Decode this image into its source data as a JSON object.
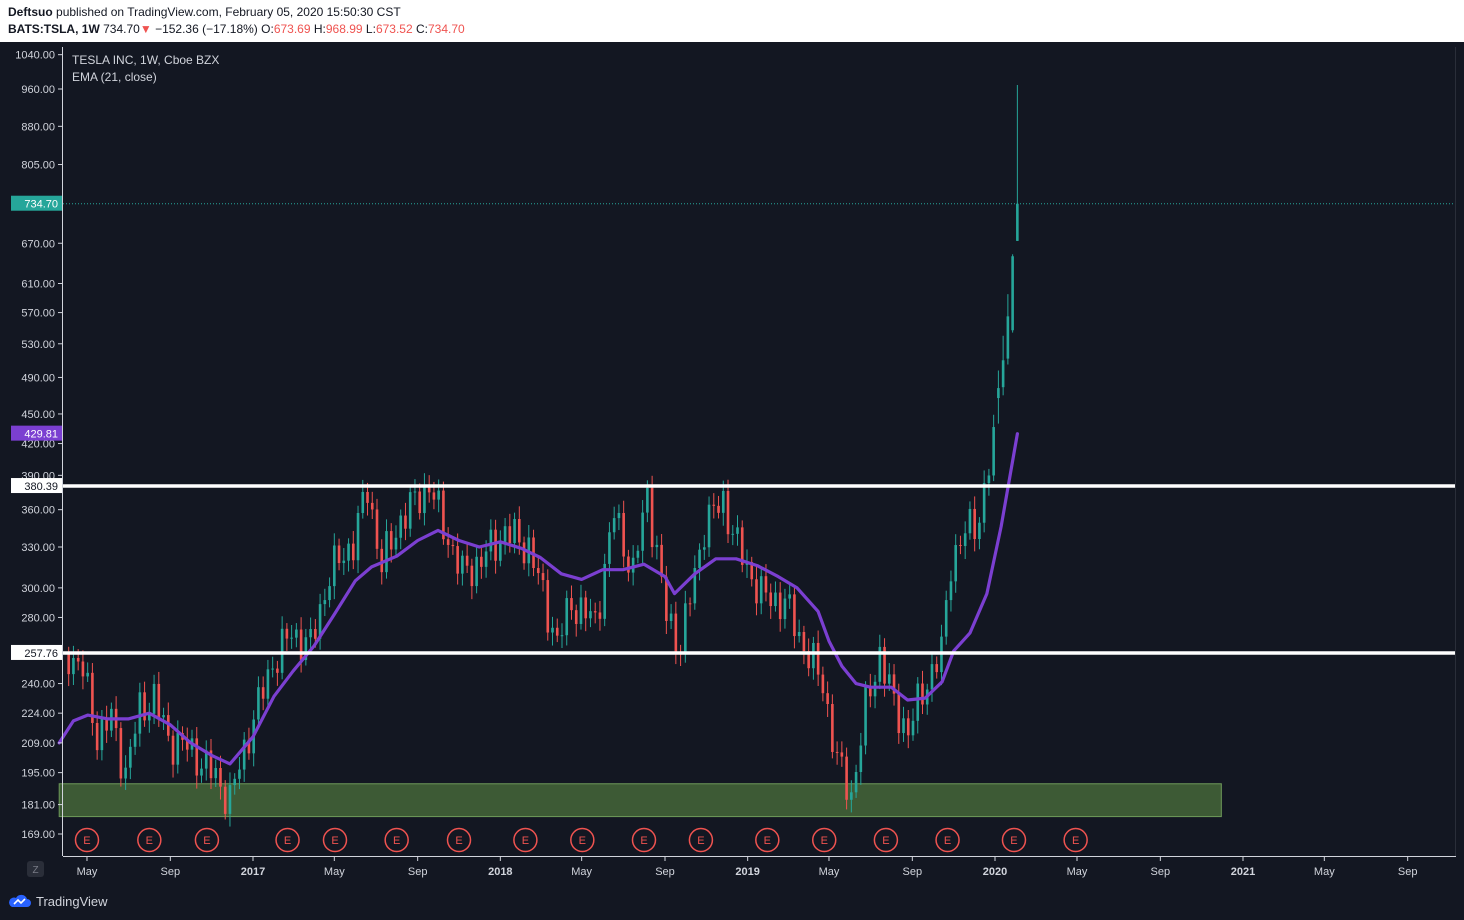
{
  "header": {
    "author": "Deftsuo",
    "published_text": "published on TradingView.com, February 05, 2020 15:50:30 CST",
    "symbol": "BATS:TSLA, 1W",
    "last": "734.70",
    "change_arrow": "▼",
    "change": "−152.36 (−17.18%)",
    "open_label": "O:",
    "open": "673.69",
    "high_label": "H:",
    "high": "968.99",
    "low_label": "L:",
    "low": "673.52",
    "close_label": "C:",
    "close": "734.70"
  },
  "legend": {
    "title": "TESLA INC, 1W, Cboe BZX",
    "indicator": "EMA (21, close)"
  },
  "footer": {
    "brand": "TradingView",
    "corner_label": "Z"
  },
  "colors": {
    "background": "#131722",
    "up": "#26a69a",
    "down": "#ef5350",
    "ema": "#7b3fd1",
    "support_zone": "#3d5a35",
    "levels": "#ffffff",
    "earnings": "#ef5350"
  },
  "chart_data": {
    "type": "candlestick",
    "title": "TESLA INC, 1W, Cboe BZX",
    "interval": "1W",
    "y_scale": "log",
    "y_ticks": [
      1040,
      960,
      880,
      805,
      670,
      610,
      570,
      530,
      490,
      450,
      420,
      390,
      360,
      330,
      300,
      280,
      240,
      224,
      209,
      195,
      181,
      169
    ],
    "y_tick_labels": [
      "1040.00",
      "960.00",
      "880.00",
      "805.00",
      "670.00",
      "610.00",
      "570.00",
      "530.00",
      "490.00",
      "450.00",
      "420.00",
      "390.00",
      "360.00",
      "330.00",
      "300.00",
      "280.00",
      "240.00",
      "224.00",
      "209.00",
      "195.00",
      "181.00",
      "169.00"
    ],
    "x_ticks": [
      {
        "label": "May",
        "date": "2016-05-01",
        "bold": false
      },
      {
        "label": "Sep",
        "date": "2016-09-01",
        "bold": false
      },
      {
        "label": "2017",
        "date": "2017-01-01",
        "bold": true
      },
      {
        "label": "May",
        "date": "2017-05-01",
        "bold": false
      },
      {
        "label": "Sep",
        "date": "2017-09-01",
        "bold": false
      },
      {
        "label": "2018",
        "date": "2018-01-01",
        "bold": true
      },
      {
        "label": "May",
        "date": "2018-05-01",
        "bold": false
      },
      {
        "label": "Sep",
        "date": "2018-09-01",
        "bold": false
      },
      {
        "label": "2019",
        "date": "2019-01-01",
        "bold": true
      },
      {
        "label": "May",
        "date": "2019-05-01",
        "bold": false
      },
      {
        "label": "Sep",
        "date": "2019-09-01",
        "bold": false
      },
      {
        "label": "2020",
        "date": "2020-01-01",
        "bold": true
      },
      {
        "label": "May",
        "date": "2020-05-01",
        "bold": false
      },
      {
        "label": "Sep",
        "date": "2020-09-01",
        "bold": false
      },
      {
        "label": "2021",
        "date": "2021-01-01",
        "bold": true
      },
      {
        "label": "May",
        "date": "2021-05-01",
        "bold": false
      },
      {
        "label": "Sep",
        "date": "2021-09-01",
        "bold": false
      }
    ],
    "price_labels": [
      {
        "text": "734.70",
        "value": 734.7,
        "bg": "#26a69a",
        "fg": "#ffffff"
      },
      {
        "text": "429.81",
        "value": 429.81,
        "bg": "#7b3fd1",
        "fg": "#ffffff"
      },
      {
        "text": "380.39",
        "value": 380.39,
        "bg": "#ffffff",
        "fg": "#131722"
      },
      {
        "text": "257.76",
        "value": 257.76,
        "bg": "#ffffff",
        "fg": "#131722"
      }
    ],
    "horizontal_levels": [
      380.39,
      257.76
    ],
    "last_price": 734.7,
    "support_zone": {
      "from": "2016-03-21",
      "to": "2020-11-30",
      "top": 190,
      "bottom": 176
    },
    "earnings_label": "E",
    "earnings_dates": [
      "2016-05-01",
      "2016-08-01",
      "2016-10-25",
      "2017-02-21",
      "2017-05-02",
      "2017-08-01",
      "2017-11-01",
      "2018-02-07",
      "2018-05-02",
      "2018-08-01",
      "2018-10-24",
      "2019-01-30",
      "2019-04-24",
      "2019-07-24",
      "2019-10-23",
      "2020-01-29",
      "2020-04-29"
    ],
    "ema_name": "EMA (21, close)",
    "ema": [
      [
        "2016-03-21",
        209
      ],
      [
        "2016-04-11",
        220
      ],
      [
        "2016-05-02",
        223
      ],
      [
        "2016-06-01",
        221
      ],
      [
        "2016-07-01",
        221
      ],
      [
        "2016-08-01",
        224
      ],
      [
        "2016-09-01",
        218
      ],
      [
        "2016-10-01",
        209
      ],
      [
        "2016-11-01",
        203
      ],
      [
        "2016-11-28",
        199
      ],
      [
        "2017-01-01",
        212
      ],
      [
        "2017-02-01",
        233
      ],
      [
        "2017-03-01",
        247
      ],
      [
        "2017-04-01",
        262
      ],
      [
        "2017-05-01",
        282
      ],
      [
        "2017-06-01",
        305
      ],
      [
        "2017-06-25",
        315
      ],
      [
        "2017-08-01",
        323
      ],
      [
        "2017-09-01",
        335
      ],
      [
        "2017-10-01",
        343
      ],
      [
        "2017-11-01",
        335
      ],
      [
        "2017-12-01",
        330
      ],
      [
        "2018-01-01",
        334
      ],
      [
        "2018-02-01",
        329
      ],
      [
        "2018-03-01",
        322
      ],
      [
        "2018-04-01",
        310
      ],
      [
        "2018-05-01",
        306
      ],
      [
        "2018-06-01",
        313
      ],
      [
        "2018-07-01",
        313
      ],
      [
        "2018-08-01",
        317
      ],
      [
        "2018-09-01",
        308
      ],
      [
        "2018-09-15",
        296
      ],
      [
        "2018-10-15",
        310
      ],
      [
        "2018-11-15",
        321
      ],
      [
        "2018-12-15",
        321
      ],
      [
        "2019-01-15",
        316
      ],
      [
        "2019-02-15",
        308
      ],
      [
        "2019-03-15",
        300
      ],
      [
        "2019-04-15",
        284
      ],
      [
        "2019-05-01",
        265
      ],
      [
        "2019-05-20",
        250
      ],
      [
        "2019-06-10",
        240
      ],
      [
        "2019-07-01",
        238
      ],
      [
        "2019-08-01",
        238
      ],
      [
        "2019-08-25",
        231
      ],
      [
        "2019-09-20",
        232
      ],
      [
        "2019-10-15",
        241
      ],
      [
        "2019-11-01",
        259
      ],
      [
        "2019-11-25",
        270
      ],
      [
        "2019-12-20",
        296
      ],
      [
        "2020-01-10",
        346
      ],
      [
        "2020-02-03",
        429.81
      ]
    ],
    "candles_2020": [
      {
        "date": "2020-01-06",
        "open": 467,
        "high": 498,
        "low": 440,
        "close": 478
      },
      {
        "date": "2020-01-13",
        "open": 479,
        "high": 540,
        "low": 470,
        "close": 510
      },
      {
        "date": "2020-01-20",
        "open": 512,
        "high": 595,
        "low": 505,
        "close": 565
      },
      {
        "date": "2020-01-27",
        "open": 547,
        "high": 653,
        "low": 544,
        "close": 650
      },
      {
        "date": "2020-02-03",
        "open": 673.69,
        "high": 968.99,
        "low": 673.52,
        "close": 734.7
      }
    ],
    "ohlc": {
      "open": 673.69,
      "high": 968.99,
      "low": 673.52,
      "close": 734.7,
      "change": -152.36,
      "change_pct": -17.18
    }
  }
}
